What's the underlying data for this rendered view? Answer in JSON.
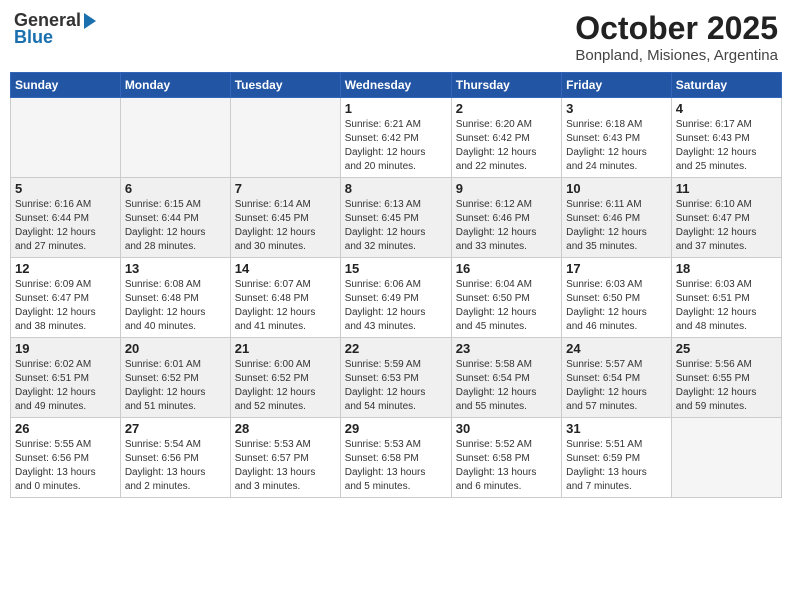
{
  "header": {
    "logo_general": "General",
    "logo_blue": "Blue",
    "month": "October 2025",
    "location": "Bonpland, Misiones, Argentina"
  },
  "weekdays": [
    "Sunday",
    "Monday",
    "Tuesday",
    "Wednesday",
    "Thursday",
    "Friday",
    "Saturday"
  ],
  "weeks": [
    [
      {
        "day": "",
        "info": ""
      },
      {
        "day": "",
        "info": ""
      },
      {
        "day": "",
        "info": ""
      },
      {
        "day": "1",
        "info": "Sunrise: 6:21 AM\nSunset: 6:42 PM\nDaylight: 12 hours\nand 20 minutes."
      },
      {
        "day": "2",
        "info": "Sunrise: 6:20 AM\nSunset: 6:42 PM\nDaylight: 12 hours\nand 22 minutes."
      },
      {
        "day": "3",
        "info": "Sunrise: 6:18 AM\nSunset: 6:43 PM\nDaylight: 12 hours\nand 24 minutes."
      },
      {
        "day": "4",
        "info": "Sunrise: 6:17 AM\nSunset: 6:43 PM\nDaylight: 12 hours\nand 25 minutes."
      }
    ],
    [
      {
        "day": "5",
        "info": "Sunrise: 6:16 AM\nSunset: 6:44 PM\nDaylight: 12 hours\nand 27 minutes."
      },
      {
        "day": "6",
        "info": "Sunrise: 6:15 AM\nSunset: 6:44 PM\nDaylight: 12 hours\nand 28 minutes."
      },
      {
        "day": "7",
        "info": "Sunrise: 6:14 AM\nSunset: 6:45 PM\nDaylight: 12 hours\nand 30 minutes."
      },
      {
        "day": "8",
        "info": "Sunrise: 6:13 AM\nSunset: 6:45 PM\nDaylight: 12 hours\nand 32 minutes."
      },
      {
        "day": "9",
        "info": "Sunrise: 6:12 AM\nSunset: 6:46 PM\nDaylight: 12 hours\nand 33 minutes."
      },
      {
        "day": "10",
        "info": "Sunrise: 6:11 AM\nSunset: 6:46 PM\nDaylight: 12 hours\nand 35 minutes."
      },
      {
        "day": "11",
        "info": "Sunrise: 6:10 AM\nSunset: 6:47 PM\nDaylight: 12 hours\nand 37 minutes."
      }
    ],
    [
      {
        "day": "12",
        "info": "Sunrise: 6:09 AM\nSunset: 6:47 PM\nDaylight: 12 hours\nand 38 minutes."
      },
      {
        "day": "13",
        "info": "Sunrise: 6:08 AM\nSunset: 6:48 PM\nDaylight: 12 hours\nand 40 minutes."
      },
      {
        "day": "14",
        "info": "Sunrise: 6:07 AM\nSunset: 6:48 PM\nDaylight: 12 hours\nand 41 minutes."
      },
      {
        "day": "15",
        "info": "Sunrise: 6:06 AM\nSunset: 6:49 PM\nDaylight: 12 hours\nand 43 minutes."
      },
      {
        "day": "16",
        "info": "Sunrise: 6:04 AM\nSunset: 6:50 PM\nDaylight: 12 hours\nand 45 minutes."
      },
      {
        "day": "17",
        "info": "Sunrise: 6:03 AM\nSunset: 6:50 PM\nDaylight: 12 hours\nand 46 minutes."
      },
      {
        "day": "18",
        "info": "Sunrise: 6:03 AM\nSunset: 6:51 PM\nDaylight: 12 hours\nand 48 minutes."
      }
    ],
    [
      {
        "day": "19",
        "info": "Sunrise: 6:02 AM\nSunset: 6:51 PM\nDaylight: 12 hours\nand 49 minutes."
      },
      {
        "day": "20",
        "info": "Sunrise: 6:01 AM\nSunset: 6:52 PM\nDaylight: 12 hours\nand 51 minutes."
      },
      {
        "day": "21",
        "info": "Sunrise: 6:00 AM\nSunset: 6:52 PM\nDaylight: 12 hours\nand 52 minutes."
      },
      {
        "day": "22",
        "info": "Sunrise: 5:59 AM\nSunset: 6:53 PM\nDaylight: 12 hours\nand 54 minutes."
      },
      {
        "day": "23",
        "info": "Sunrise: 5:58 AM\nSunset: 6:54 PM\nDaylight: 12 hours\nand 55 minutes."
      },
      {
        "day": "24",
        "info": "Sunrise: 5:57 AM\nSunset: 6:54 PM\nDaylight: 12 hours\nand 57 minutes."
      },
      {
        "day": "25",
        "info": "Sunrise: 5:56 AM\nSunset: 6:55 PM\nDaylight: 12 hours\nand 59 minutes."
      }
    ],
    [
      {
        "day": "26",
        "info": "Sunrise: 5:55 AM\nSunset: 6:56 PM\nDaylight: 13 hours\nand 0 minutes."
      },
      {
        "day": "27",
        "info": "Sunrise: 5:54 AM\nSunset: 6:56 PM\nDaylight: 13 hours\nand 2 minutes."
      },
      {
        "day": "28",
        "info": "Sunrise: 5:53 AM\nSunset: 6:57 PM\nDaylight: 13 hours\nand 3 minutes."
      },
      {
        "day": "29",
        "info": "Sunrise: 5:53 AM\nSunset: 6:58 PM\nDaylight: 13 hours\nand 5 minutes."
      },
      {
        "day": "30",
        "info": "Sunrise: 5:52 AM\nSunset: 6:58 PM\nDaylight: 13 hours\nand 6 minutes."
      },
      {
        "day": "31",
        "info": "Sunrise: 5:51 AM\nSunset: 6:59 PM\nDaylight: 13 hours\nand 7 minutes."
      },
      {
        "day": "",
        "info": ""
      }
    ]
  ]
}
